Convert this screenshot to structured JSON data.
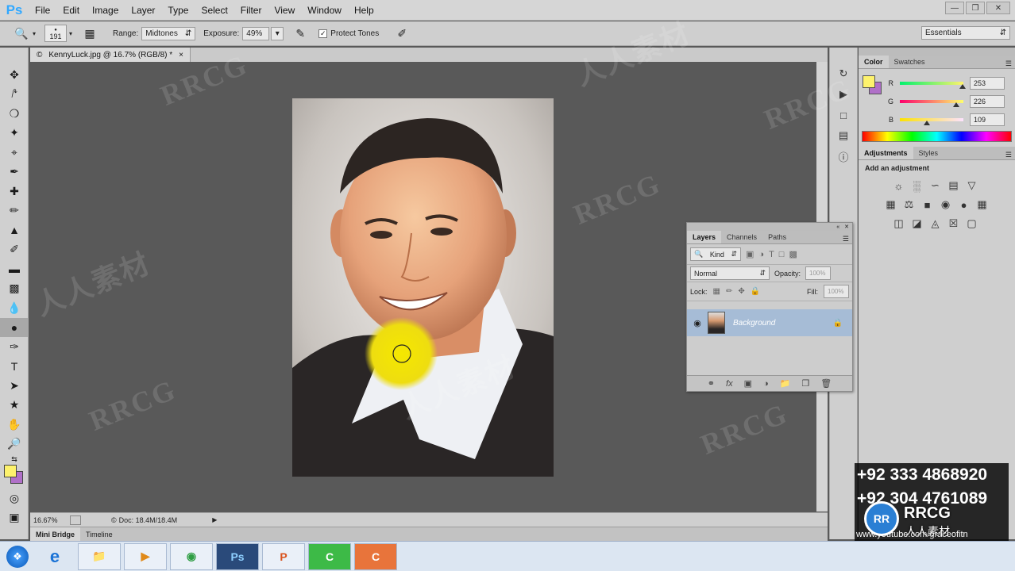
{
  "app": {
    "logo": "Ps",
    "menu": [
      "File",
      "Edit",
      "Image",
      "Layer",
      "Type",
      "Select",
      "Filter",
      "View",
      "Window",
      "Help"
    ]
  },
  "options": {
    "brush_size": "191",
    "range_label": "Range:",
    "range_value": "Midtones",
    "exposure_label": "Exposure:",
    "exposure_value": "49%",
    "protect_tones_label": "Protect Tones",
    "protect_tones_checked": true,
    "workspace": "Essentials"
  },
  "document": {
    "tab_title": "KennyLuck.jpg @ 16.7% (RGB/8) *",
    "zoom": "16.67%",
    "doc_info": "Doc: 18.4M/18.4M"
  },
  "bottom_tabs": [
    "Mini Bridge",
    "Timeline"
  ],
  "color_panel": {
    "tabs": [
      "Color",
      "Swatches"
    ],
    "foreground": "#fdf26d",
    "background": "#b070c8",
    "channels": [
      {
        "label": "R",
        "value": "253",
        "level": 0.99
      },
      {
        "label": "G",
        "value": "226",
        "level": 0.89
      },
      {
        "label": "B",
        "value": "109",
        "level": 0.43
      }
    ]
  },
  "adjustments_panel": {
    "tabs": [
      "Adjustments",
      "Styles"
    ],
    "heading": "Add an adjustment"
  },
  "layers_panel": {
    "tabs": [
      "Layers",
      "Channels",
      "Paths"
    ],
    "filter_kind": "Kind",
    "blend_mode": "Normal",
    "opacity_label": "Opacity:",
    "opacity_value": "100%",
    "lock_label": "Lock:",
    "fill_label": "Fill:",
    "fill_value": "100%",
    "layers": [
      {
        "name": "Background",
        "locked": true,
        "visible": true
      }
    ]
  },
  "overlay": {
    "phones": [
      "+92 333 4868920",
      "+92 304 4761089"
    ],
    "url": "www.youtube.com/graceofitn",
    "watermark": "RRCG",
    "watermark_cn": "人人素材"
  },
  "colors": {
    "accent": "#31a8ff",
    "dodge_spot": "#f5e800"
  }
}
